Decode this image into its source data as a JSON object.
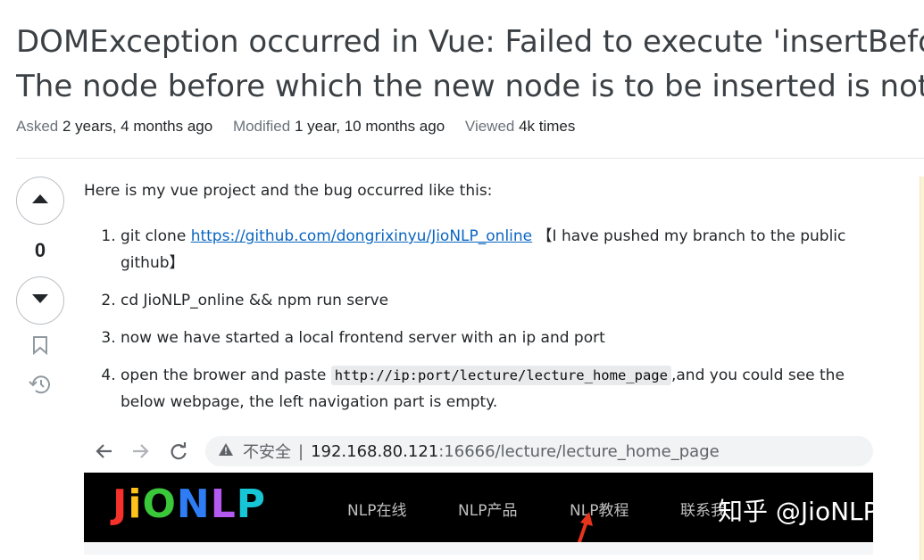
{
  "question": {
    "title_line1": "DOMException occurred in Vue: Failed to execute 'insertBefore' on 'Node':",
    "title_line2": "The node before which the new node is to be inserted is not a child of this node."
  },
  "meta": {
    "asked_label": "Asked",
    "asked_value": "2 years, 4 months ago",
    "modified_label": "Modified",
    "modified_value": "1 year, 10 months ago",
    "viewed_label": "Viewed",
    "viewed_value": "4k times"
  },
  "vote": {
    "count": "0"
  },
  "icons": {
    "upvote": "caret-up-icon",
    "downvote": "caret-down-icon",
    "bookmark": "bookmark-icon",
    "history": "history-icon"
  },
  "post": {
    "intro": "Here is my vue project and the bug occurred like this:",
    "step1_prefix": "git clone ",
    "step1_link": "https://github.com/dongrixinyu/JioNLP_online",
    "step1_suffix": " 【I have pushed my branch to the public github】",
    "step2": "cd JioNLP_online && npm run serve",
    "step3": "now we have started a local frontend server with an ip and port",
    "step4_prefix": "open the brower and paste ",
    "step4_code": "http://ip:port/lecture/lecture_home_page",
    "step4_suffix": ",and you could see the below webpage, the left navigation part is empty."
  },
  "screenshot": {
    "insecure_label": "不安全",
    "separator": "|",
    "url_host": "192.168.80.121",
    "url_rest": ":16666/lecture/lecture_home_page",
    "logo_letters": [
      "J",
      "i",
      "O",
      "N",
      "L",
      "P"
    ],
    "logo_colors": [
      "#f5312a",
      "#ffc21a",
      "#3ac83a",
      "#2e7cf6",
      "#b45af2",
      "#17c6d6"
    ],
    "nav_items": [
      "NLP在线",
      "NLP产品",
      "NLP教程",
      "联系我"
    ],
    "watermark": "知乎 @JioNLP"
  },
  "colors": {
    "link": "#0a66c2",
    "arrow": "#e8341c"
  }
}
